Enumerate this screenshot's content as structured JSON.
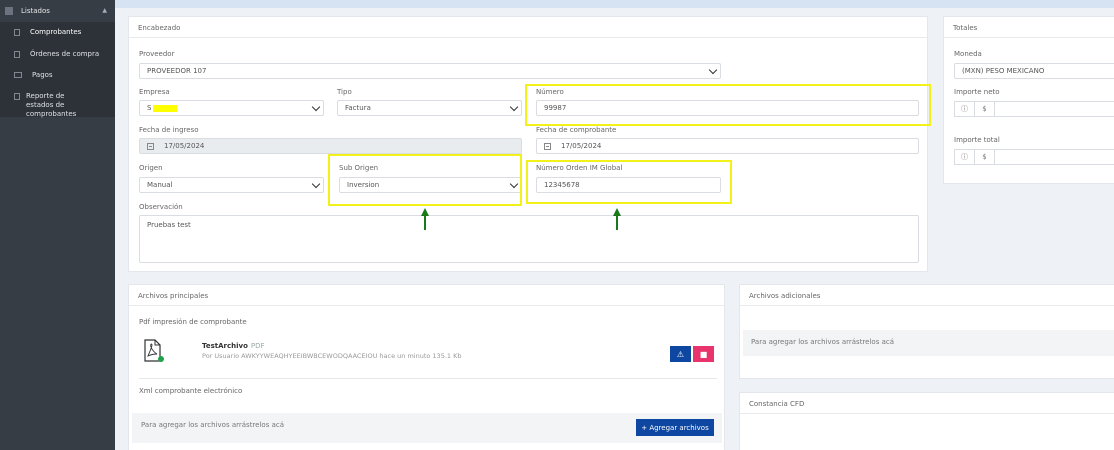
{
  "sidebar": {
    "section_label": "Listados",
    "items": [
      {
        "label": "Comprobantes",
        "active": true
      },
      {
        "label": "Órdenes de compra"
      },
      {
        "label": "Pagos"
      },
      {
        "label": "Reporte de estados de comprobantes"
      }
    ]
  },
  "encabezado": {
    "title": "Encabezado",
    "proveedor_label": "Proveedor",
    "proveedor_value": "PROVEEDOR 107",
    "empresa_label": "Empresa",
    "empresa_value": "S",
    "tipo_label": "Tipo",
    "tipo_value": "Factura",
    "numero_label": "Número",
    "numero_value": "99987",
    "fecha_ingreso_label": "Fecha de ingreso",
    "fecha_ingreso_value": "17/05/2024",
    "fecha_comprobante_label": "Fecha de comprobante",
    "fecha_comprobante_value": "17/05/2024",
    "origen_label": "Origen",
    "origen_value": "Manual",
    "sub_origen_label": "Sub Origen",
    "sub_origen_value": "Inversion",
    "numero_orden_label": "Número Orden IM Global",
    "numero_orden_value": "12345678",
    "observacion_label": "Observación",
    "observacion_value": "Pruebas test"
  },
  "totales": {
    "title": "Totales",
    "moneda_label": "Moneda",
    "moneda_value": "(MXN) PESO MEXICANO",
    "importe_neto_label": "Importe neto",
    "importe_total_label": "Importe total",
    "currency_symbol": "$"
  },
  "archivos_principales": {
    "title": "Archivos principales",
    "pdf_section_label": "Pdf impresión de comprobante",
    "file_name": "TestArchivo",
    "file_ext": "PDF",
    "file_meta": "Por Usuario AWKYYWEAQHYEEIBWBCEWODQAACEIOU hace un minuto  135.1 Kb",
    "xml_section_label": "Xml comprobante electrónico",
    "drop_text": "Para agregar los archivos arrástrelos acá",
    "add_button_label": "+ Agregar archivos"
  },
  "archivos_adicionales": {
    "title": "Archivos adicionales",
    "drop_text": "Para agregar los archivos arrástrelos acá"
  },
  "constancia": {
    "title": "Constancia CFD"
  },
  "colors": {
    "highlight": "#f2f21a",
    "arrow": "#1a7a1a",
    "primary_button": "#0d47a1",
    "delete_button": "#e8336d",
    "sidebar_bg": "#363d45"
  }
}
